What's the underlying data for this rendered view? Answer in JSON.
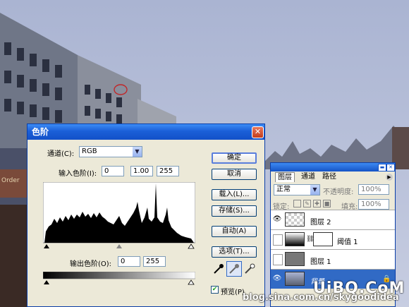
{
  "levels_dialog": {
    "title": "色阶",
    "close_glyph": "✕",
    "channel_label": "通道(C):",
    "channel_value": "RGB",
    "input_levels_label": "输入色阶(I):",
    "input_levels": [
      "0",
      "1.00",
      "255"
    ],
    "output_levels_label": "输出色阶(O):",
    "output_levels": [
      "0",
      "255"
    ],
    "buttons": {
      "ok": "确定",
      "cancel": "取消",
      "load": "载入(L)...",
      "save": "存储(S)...",
      "auto": "自动(A)",
      "options": "选项(T)..."
    },
    "preview_label": "预览(P)",
    "preview_checked": true
  },
  "layers_panel": {
    "tabs": [
      "图层",
      "通道",
      "路径"
    ],
    "blend_mode": "正常",
    "opacity_label": "不透明度:",
    "opacity_value": "100%",
    "lock_label": "锁定:",
    "fill_label": "填充:",
    "fill_value": "100%",
    "layers": [
      {
        "name": "图层 2",
        "visible": true
      },
      {
        "name": "阈值 1",
        "visible": false
      },
      {
        "name": "图层 1",
        "visible": false
      },
      {
        "name": "背景",
        "visible": true
      }
    ]
  },
  "watermarks": {
    "site": "UiBQ.CoM",
    "blog": "blog.sina.com.cn/skygoodidea"
  },
  "icons": {
    "eye": "eye-icon",
    "link": "chain-link-icon",
    "lock": "lock-icon",
    "eyedropper": "eyedropper-icon",
    "menu": "panel-menu-icon"
  }
}
